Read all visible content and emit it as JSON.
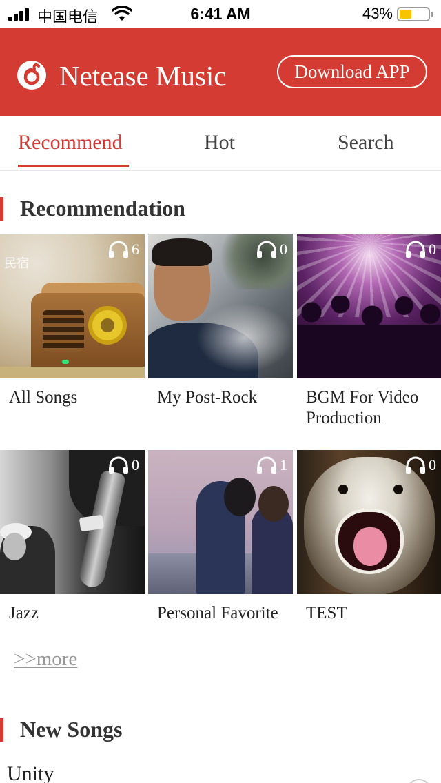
{
  "status_bar": {
    "carrier": "中国电信",
    "time": "6:41 AM",
    "battery": "43%",
    "battery_level": 0.43,
    "icons": [
      "signal-icon",
      "wifi-icon",
      "battery-icon"
    ]
  },
  "header": {
    "logo_icon": "netease-music-logo-icon",
    "title": "Netease Music",
    "download_label": "Download APP"
  },
  "tabs": [
    {
      "label": "Recommend",
      "active": true
    },
    {
      "label": "Hot",
      "active": false
    },
    {
      "label": "Search",
      "active": false
    }
  ],
  "recommendation": {
    "title": "Recommendation",
    "playlists": [
      {
        "name": "All Songs",
        "plays": "6"
      },
      {
        "name": "My Post-Rock",
        "plays": "0"
      },
      {
        "name": "BGM For Video Production",
        "plays": "0"
      },
      {
        "name": "Jazz",
        "plays": "0"
      },
      {
        "name": "Personal Favorite",
        "plays": "1"
      },
      {
        "name": "TEST",
        "plays": "0"
      }
    ],
    "cover_text": "民宿",
    "more_label": ">>more"
  },
  "new_songs": {
    "title": "New Songs",
    "songs": [
      {
        "name": "Unity"
      }
    ]
  },
  "colors": {
    "brand_red": "#d43c33",
    "tab_inactive": "#444444",
    "battery_yellow": "#f6c400"
  }
}
